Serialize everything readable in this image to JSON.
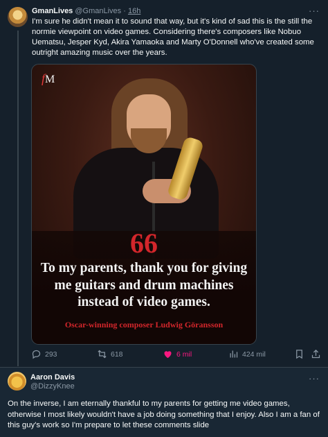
{
  "post": {
    "author_name": "GmanLives",
    "author_handle": "@GmanLives",
    "separator": "·",
    "time": "16h",
    "more": "···",
    "text": "I'm sure he didn't mean it to sound that way, but it's kind of sad this is the still the normie viewpoint on video games. Considering there's composers like Nobuo Uematsu, Jesper Kyd, Akira Yamaoka and Marty O'Donnell who've created some outright amazing music over the years.",
    "media": {
      "logo_mark": "f",
      "logo_text": "M",
      "quote_mark": "66",
      "quote": "To my parents, thank you for giving me guitars and drum machines instead of video games.",
      "caption": "Oscar-winning composer Ludwig Göransson"
    },
    "actions": {
      "replies": "293",
      "retweets": "618",
      "likes": "6 mil",
      "views": "424 mil"
    }
  },
  "reply": {
    "author_name": "Aaron Davis",
    "author_handle": "@DizzyKnee",
    "text": "On the inverse, I am eternally thankful  to my parents for getting me video games, otherwise I most likely wouldn't have a job doing something that I enjoy. Also I am a fan of this guy's work so I'm prepare to let these comments slide"
  },
  "colors": {
    "background": "#15202b",
    "text": "#f7f9f9",
    "secondary": "#8b98a5",
    "like": "#f91880",
    "quote_red": "#d3262b"
  }
}
